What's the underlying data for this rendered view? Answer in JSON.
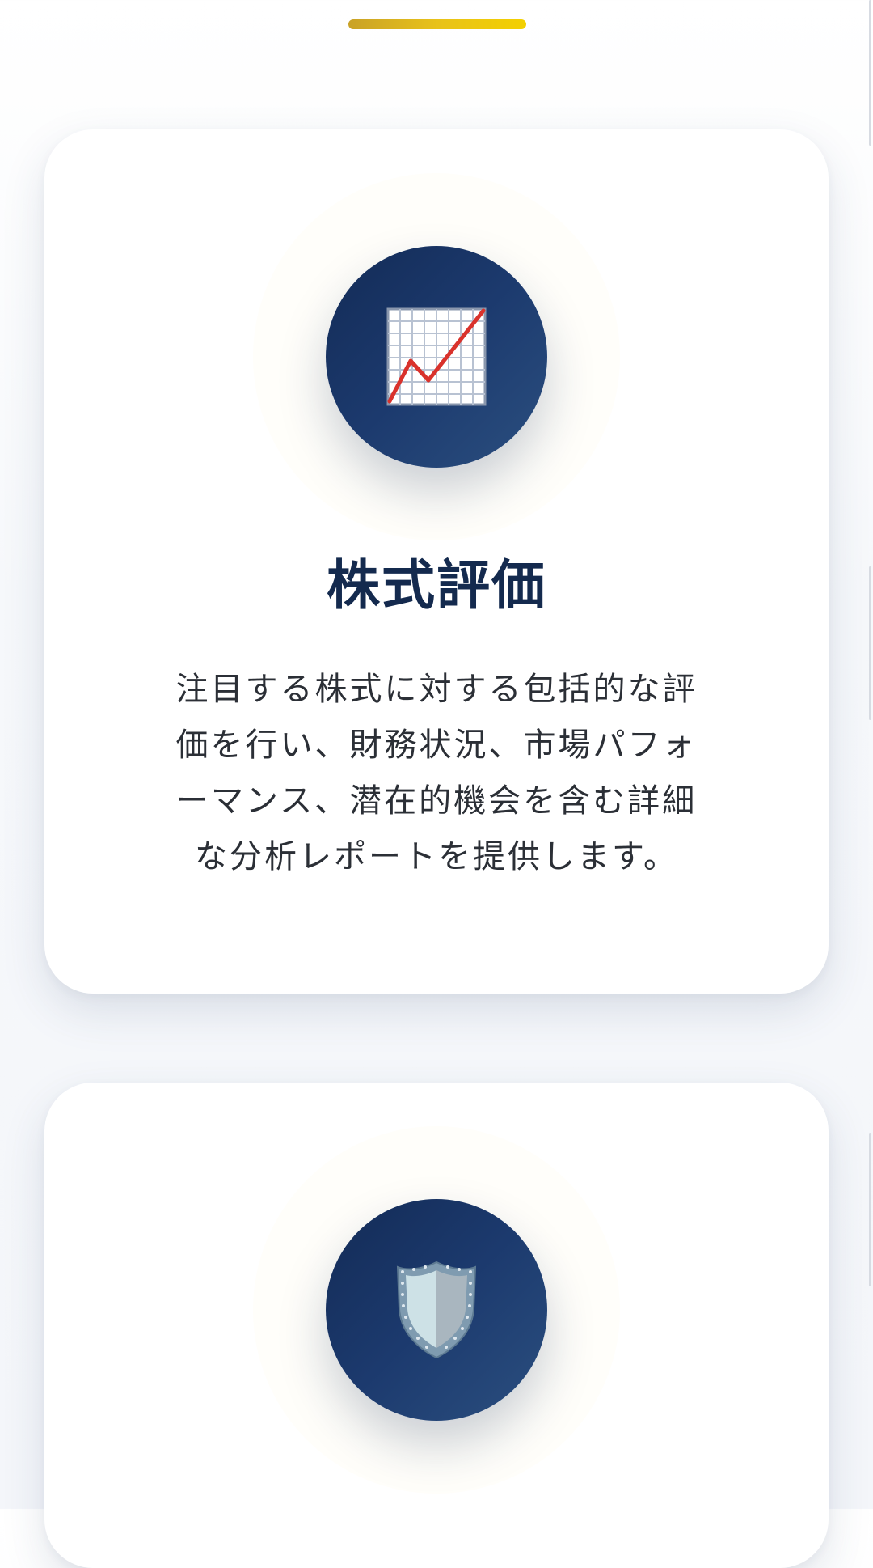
{
  "colors": {
    "accent_gold": "#e8c21a",
    "navy": "#142a4e",
    "icon_bg": "#1c3a6e",
    "chart_line": "#d9322c"
  },
  "cards": [
    {
      "icon": "chart-increasing-icon",
      "title": "株式評価",
      "description": "注目する株式に対する包括的な評価を行い、財務状況、市場パフォーマンス、潜在的機会を含む詳細な分析レポートを提供します。"
    },
    {
      "icon": "shield-icon"
    }
  ]
}
